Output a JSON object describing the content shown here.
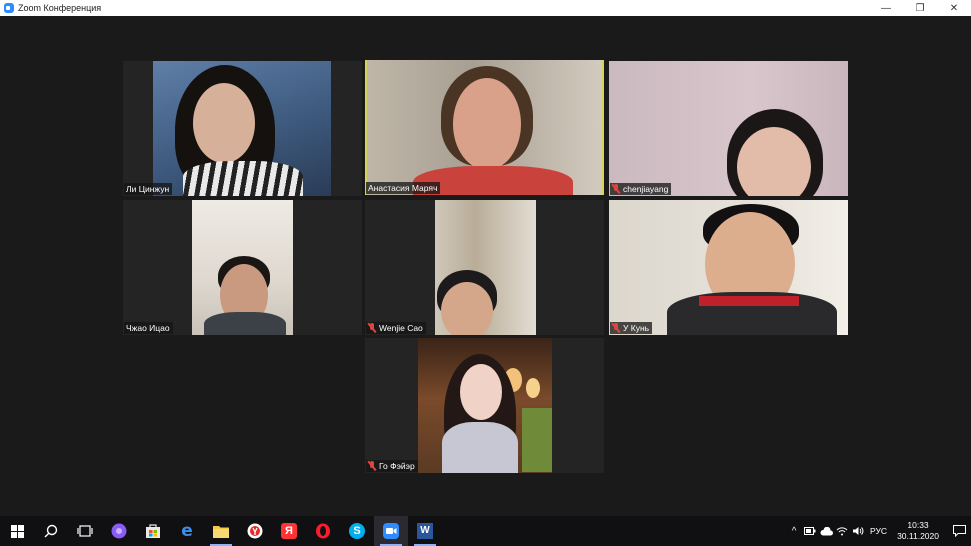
{
  "window": {
    "title": "Zoom Конференция",
    "minimize": "—",
    "maximize": "❐",
    "close": "✕"
  },
  "participants": [
    {
      "name": "Ли Цинжун",
      "muted": false,
      "active": false
    },
    {
      "name": "Анастасия Маряч",
      "muted": false,
      "active": true
    },
    {
      "name": "chenjiayang",
      "muted": true,
      "active": false
    },
    {
      "name": "Чжао Ицао",
      "muted": false,
      "active": false
    },
    {
      "name": "Wenjie Cao",
      "muted": true,
      "active": false
    },
    {
      "name": "У Кунь",
      "muted": true,
      "active": false
    },
    {
      "name": "Го Фэйэр",
      "muted": true,
      "active": false
    }
  ],
  "colors": {
    "active_speaker_border": "#d7d25a",
    "muted_icon": "#e0443e",
    "zoom_blue": "#2d8cff"
  },
  "taskbar": {
    "apps": [
      "windows-start",
      "search",
      "task-view",
      "alice",
      "store",
      "edge",
      "file-explorer",
      "yandex-browser",
      "yandex",
      "opera",
      "skype",
      "zoom",
      "word"
    ],
    "language": "РУС",
    "time": "10:33",
    "date": "30.11.2020"
  }
}
